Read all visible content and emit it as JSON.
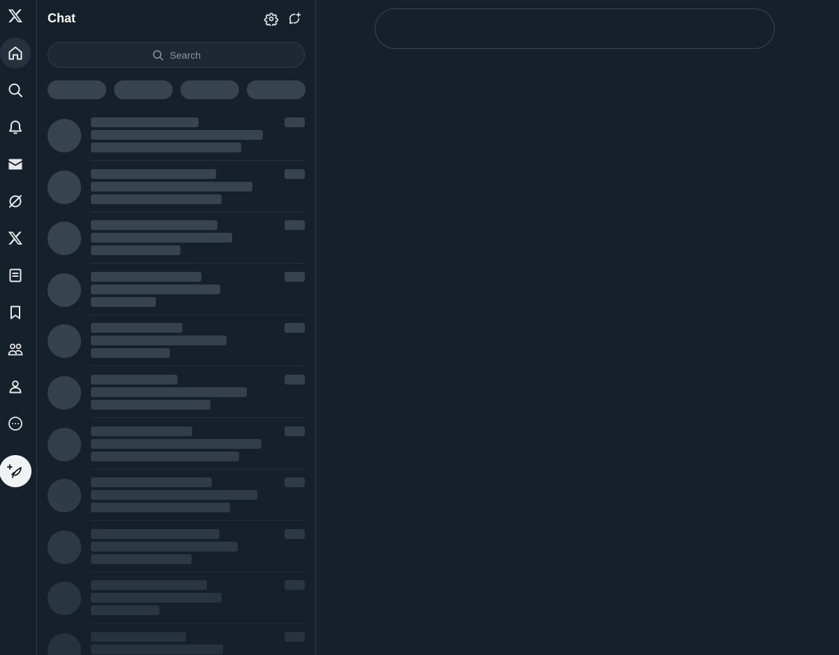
{
  "chat_header": {
    "title": "Chat",
    "settings_icon": "gear-icon",
    "new_message_icon": "new-message-icon"
  },
  "search": {
    "placeholder": "Search",
    "icon": "search-icon"
  },
  "nav": {
    "items": [
      {
        "name": "x-logo-icon",
        "active": false
      },
      {
        "name": "home-icon",
        "active": true
      },
      {
        "name": "explore-icon",
        "active": false
      },
      {
        "name": "notifications-icon",
        "active": false
      },
      {
        "name": "messages-icon",
        "active": false
      },
      {
        "name": "grok-icon",
        "active": false
      },
      {
        "name": "premium-icon",
        "active": false
      },
      {
        "name": "lists-icon",
        "active": false
      },
      {
        "name": "bookmarks-icon",
        "active": false
      },
      {
        "name": "communities-icon",
        "active": false
      },
      {
        "name": "profile-icon",
        "active": false
      },
      {
        "name": "more-icon",
        "active": false
      }
    ],
    "compose_icon": "compose-post-icon"
  },
  "filters": {
    "count": 4,
    "state": "loading"
  },
  "conversations": {
    "state": "loading",
    "count": 11
  },
  "colors": {
    "background": "#15202b",
    "skeleton": "#37444f",
    "border": "#2f3b47",
    "text": "#e7e9ea",
    "compose_bg": "#eff3f4"
  }
}
